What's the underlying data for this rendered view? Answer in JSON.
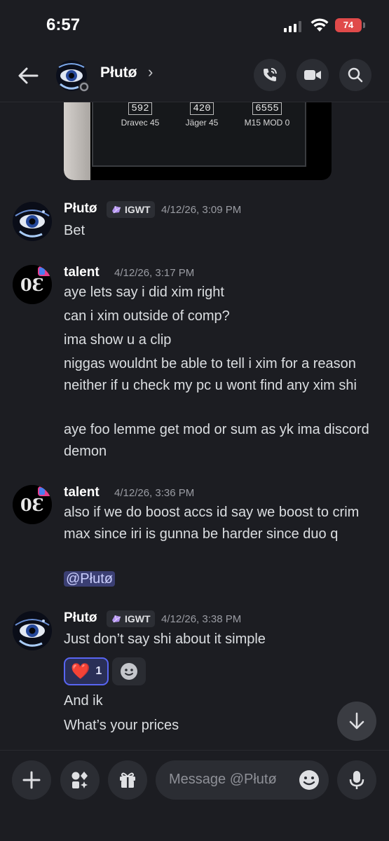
{
  "status_bar": {
    "time": "6:57",
    "battery": "74"
  },
  "header": {
    "name": "Płutø"
  },
  "embed": {
    "stats": [
      {
        "value": "592",
        "label": "Dravec 45"
      },
      {
        "value": "420",
        "label": "Jäger 45"
      },
      {
        "value": "6555",
        "label": "M15 MOD 0"
      }
    ]
  },
  "messages": [
    {
      "author": "Płutø",
      "tag": "IGWT",
      "timestamp": "4/12/26, 3:09 PM",
      "lines": [
        "Bet"
      ]
    },
    {
      "author": "talent",
      "timestamp": "4/12/26, 3:17 PM",
      "lines": [
        "aye lets say i did xim right",
        "can i xim outside of comp?",
        "ima show u a clip",
        "niggas wouldnt be able to tell i xim for a reason neither if u check my pc u wont find any xim shi",
        "aye foo lemme get mod or sum as yk ima discord demon"
      ]
    },
    {
      "author": "talent",
      "timestamp": "4/12/26, 3:36 PM",
      "lines": [
        "also if we do boost accs id say we boost to crim max since iri is gunna be harder since duo q"
      ],
      "mention": "@Płutø"
    },
    {
      "author": "Płutø",
      "tag": "IGWT",
      "timestamp": "4/12/26, 3:38 PM",
      "lines": [
        "Just don’t say shi about it simple"
      ],
      "reaction": {
        "emoji": "❤️",
        "count": "1"
      },
      "after_lines": [
        "And ik",
        "What’s your prices"
      ]
    }
  ],
  "composer": {
    "placeholder": "Message @Płutø"
  }
}
